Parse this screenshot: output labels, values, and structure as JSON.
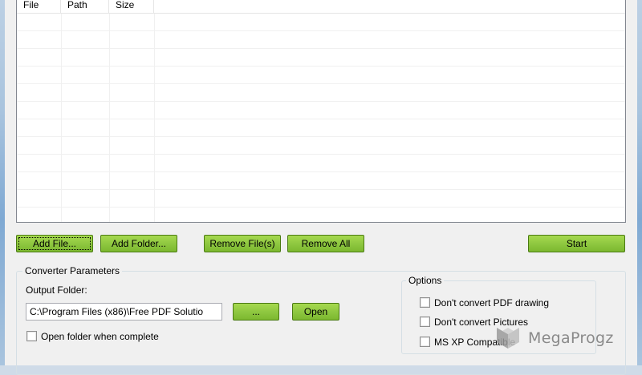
{
  "file_list": {
    "columns": [
      "File",
      "Path",
      "Size"
    ],
    "rows": 11
  },
  "toolbar": {
    "add_file": "Add File...",
    "add_folder": "Add Folder...",
    "remove_files": "Remove File(s)",
    "remove_all": "Remove All",
    "start": "Start"
  },
  "converter_params": {
    "title": "Converter Parameters",
    "output_folder_label": "Output Folder:",
    "output_folder_value": "C:\\Program Files (x86)\\Free PDF Solutio",
    "browse_label": "...",
    "open_label": "Open",
    "open_when_complete_label": "Open folder when complete"
  },
  "options": {
    "title": "Options",
    "items": [
      {
        "label": "Don't convert PDF drawing",
        "checked": false
      },
      {
        "label": "Don't convert Pictures",
        "checked": false
      },
      {
        "label": "MS XP Compatible",
        "checked": false
      }
    ]
  },
  "watermark": {
    "text": "MegaProgz",
    "logo_icon": "megaprogz-logo-icon"
  }
}
